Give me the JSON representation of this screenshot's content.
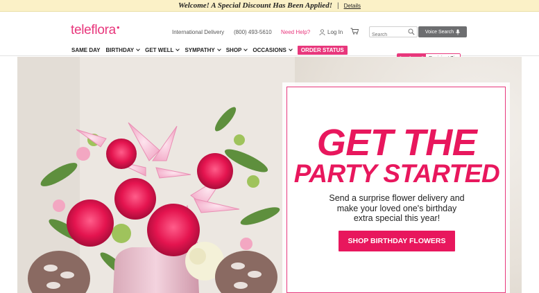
{
  "promo": {
    "message": "Welcome! A Special Discount Has Been Applied!",
    "separator": "|",
    "details": "Details"
  },
  "header": {
    "logo": "teleflora",
    "international": "International Delivery",
    "phone": "(800) 493-5610",
    "help": "Need Help?",
    "login": "Log In",
    "search_placeholder": "Search",
    "voice_search": "Voice Search"
  },
  "nav": {
    "items": [
      "SAME DAY",
      "BIRTHDAY",
      "GET WELL",
      "SYMPATHY",
      "SHOP",
      "OCCASIONS"
    ],
    "order_status": "ORDER STATUS"
  },
  "hurry": {
    "label": "In a hurry?",
    "zip_placeholder": "Recipient Zip"
  },
  "hero": {
    "headline_line1": "GET THE",
    "headline_line2": "PARTY STARTED",
    "body_line1": "Send a surprise flower delivery and",
    "body_line2": "make your loved one's birthday",
    "body_line3": "extra special this year!",
    "cta": "SHOP BIRTHDAY FLOWERS"
  },
  "colors": {
    "brand_pink": "#e8377c",
    "cta_pink": "#e8175d",
    "promo_bg": "#fbf1c7",
    "voice_bg": "#6d6e70"
  }
}
